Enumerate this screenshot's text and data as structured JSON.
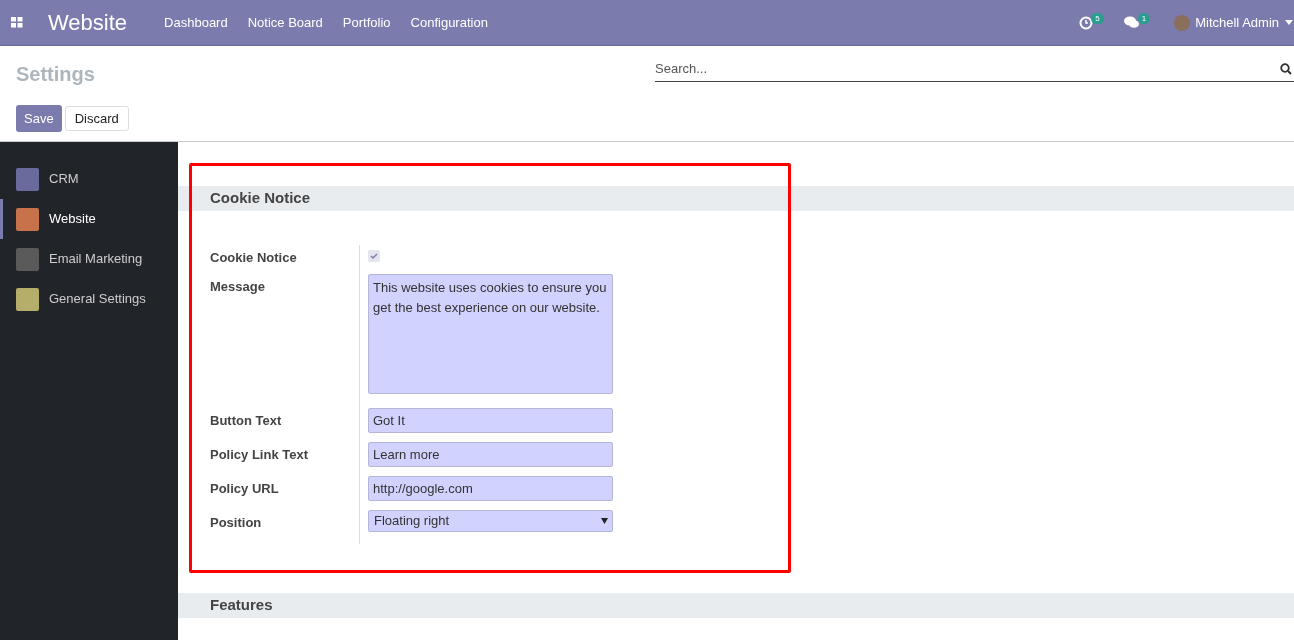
{
  "navbar": {
    "app_name": "Website",
    "menu": [
      "Dashboard",
      "Notice Board",
      "Portfolio",
      "Configuration"
    ],
    "activity_count": "5",
    "message_count": "1",
    "user_name": "Mitchell Admin"
  },
  "control_panel": {
    "breadcrumb": "Settings",
    "search": {
      "placeholder": "Search..."
    },
    "buttons": [
      {
        "label": "Save",
        "kind": "primary"
      },
      {
        "label": "Discard",
        "kind": "secondary"
      }
    ]
  },
  "sidebar": {
    "items": [
      {
        "label": "CRM",
        "selected": false,
        "color": "#6b6a9c"
      },
      {
        "label": "Website",
        "selected": true,
        "color": "#c7724a"
      },
      {
        "label": "Email Marketing",
        "selected": false,
        "color": "#5a5a5a"
      },
      {
        "label": "General Settings",
        "selected": false,
        "color": "#b5ae6b"
      }
    ]
  },
  "sections": [
    {
      "title": "Cookie Notice",
      "highlighted": true,
      "fields": [
        {
          "kind": "checkbox",
          "label": "Cookie Notice",
          "checked": true
        },
        {
          "kind": "textarea",
          "label": "Message",
          "value": "This website uses cookies to ensure you get the best experience on our website."
        },
        {
          "kind": "text",
          "label": "Button Text",
          "value": "Got It"
        },
        {
          "kind": "text",
          "label": "Policy Link Text",
          "value": "Learn more"
        },
        {
          "kind": "text",
          "label": "Policy URL",
          "value": "http://google.com"
        },
        {
          "kind": "select",
          "label": "Position",
          "value": "Floating right"
        }
      ]
    },
    {
      "title": "Features"
    }
  ]
}
